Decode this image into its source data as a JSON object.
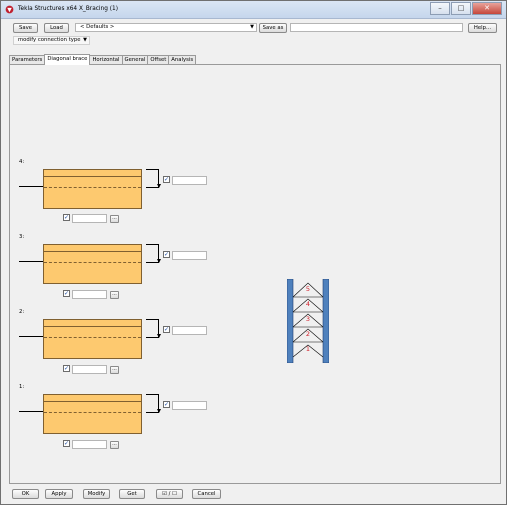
{
  "window": {
    "title": "Tekla Structures x64  X_Bracing (1)"
  },
  "toolbar": {
    "save_label": "Save",
    "load_label": "Load",
    "preset_value": "< Defaults >",
    "save_as_label": "Save as",
    "save_as_value": "",
    "help_label": "Help..."
  },
  "modify_connection": {
    "value": "modify connection type"
  },
  "tabs": [
    {
      "label": "Parameters",
      "active": false
    },
    {
      "label": "Diagonal brace",
      "active": true
    },
    {
      "label": "Horizontal",
      "active": false
    },
    {
      "label": "General",
      "active": false
    },
    {
      "label": "Offset",
      "active": false
    },
    {
      "label": "Analysis",
      "active": false
    }
  ],
  "brace_rows": [
    {
      "label": "4:",
      "checked_top": true,
      "value_top": "",
      "checked_bottom": true,
      "value_bottom": "",
      "dots_label": "..."
    },
    {
      "label": "3:",
      "checked_top": true,
      "value_top": "",
      "checked_bottom": true,
      "value_bottom": "",
      "dots_label": "..."
    },
    {
      "label": "2:",
      "checked_top": true,
      "value_top": "",
      "checked_bottom": true,
      "value_bottom": "",
      "dots_label": "..."
    },
    {
      "label": "1:",
      "checked_top": true,
      "value_top": "",
      "checked_bottom": true,
      "value_bottom": "",
      "dots_label": "..."
    }
  ],
  "frame_diagram": {
    "level_numbers": [
      "5",
      "4",
      "3",
      "2",
      "1"
    ],
    "column_color": "#4f81bd",
    "number_color": "#d0202a"
  },
  "bottom_bar": {
    "ok_label": "OK",
    "apply_label": "Apply",
    "modify_label": "Modify",
    "get_label": "Get",
    "toggle_label": "☑ / ☐",
    "cancel_label": "Cancel"
  }
}
